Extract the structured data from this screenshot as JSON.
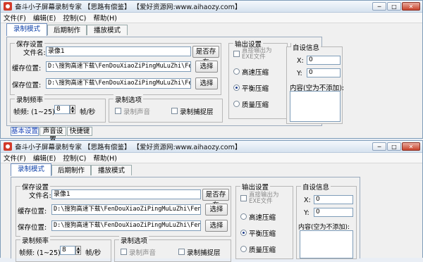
{
  "window": {
    "title": "奋斗小子屏幕录制专家 【思路有偿鉴】  【爱好资源网:www.aihaozy.com】",
    "minimize": "─",
    "maximize": "□",
    "close": "✕"
  },
  "menu": [
    "文件(F)",
    "编辑(E)",
    "控制(C)",
    "帮助(H)"
  ],
  "tabs": [
    "录制模式",
    "后期制作",
    "播放模式"
  ],
  "save_settings": {
    "label": "保存设置",
    "filename_label": "文件名:",
    "filename_value": "录像1",
    "exists_button": "是否存在",
    "cache_label": "缓存位置:",
    "cache_value": "D:\\搜狗高速下载\\FenDouXiaoZiPingMuLuZhi\\FenDouXi",
    "save_label": "保存位置:",
    "save_value": "D:\\搜狗高速下载\\FenDouXiaoZiPingMuLuZhi\\FenDouXi",
    "browse_button": "选择"
  },
  "frame_rate": {
    "label": "录制频率",
    "fps_label": "帧频: (1~25)",
    "fps_value": "8",
    "unit": "帧/秒"
  },
  "record_options": {
    "label": "录制选项",
    "record_sound": "录制声音",
    "record_cursor": "录制捕捉层"
  },
  "output_settings": {
    "label": "输出设置",
    "direct_exe": "直接输出为EXE文件",
    "options": [
      "高速压缩",
      "平衡压缩",
      "质量压缩"
    ],
    "selected": "平衡压缩"
  },
  "custom_info": {
    "label": "自设信息",
    "x_label": "X:",
    "x_value": "0",
    "y_label": "Y:",
    "y_value": "0",
    "content_label": "内容(空为不添加):"
  },
  "subtabs": [
    "基本设置",
    "声音设置",
    "快捷键"
  ]
}
